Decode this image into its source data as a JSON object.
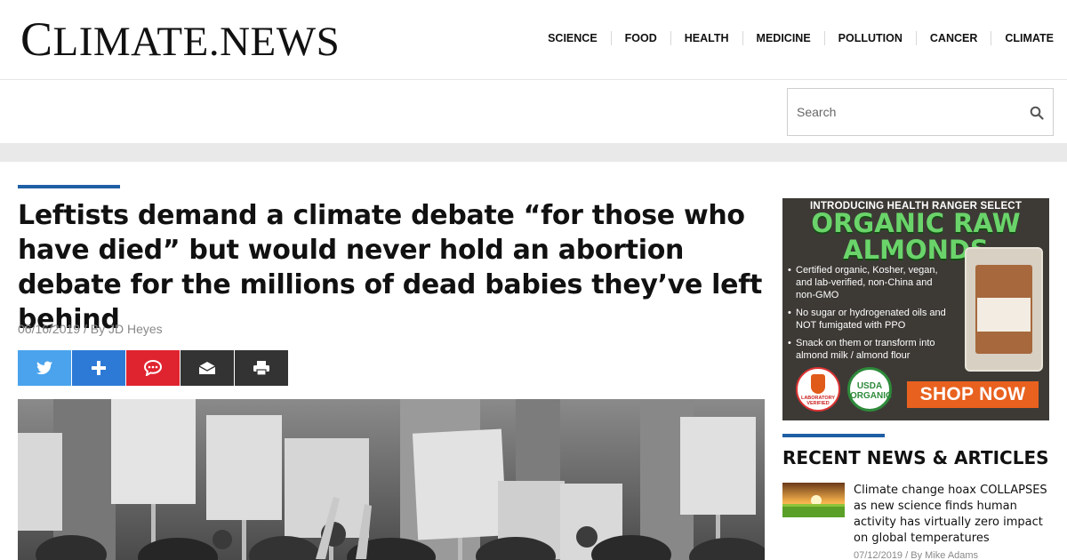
{
  "site": {
    "logo_cap": "C",
    "logo_rest": "LIMATE.NEWS"
  },
  "nav": [
    "SCIENCE",
    "FOOD",
    "HEALTH",
    "MEDICINE",
    "POLLUTION",
    "CANCER",
    "CLIMATE"
  ],
  "search": {
    "placeholder": "Search",
    "icon": "search-icon"
  },
  "article": {
    "headline": "Leftists demand a climate debate “for those who have died” but would never hold an abortion debate for the millions of dead babies they’ve left behind",
    "date": "06/16/2019",
    "separator": "/",
    "byline": "By JD Heyes",
    "share": [
      "twitter-icon",
      "plus-icon",
      "comment-icon",
      "email-icon",
      "print-icon"
    ],
    "colors": {
      "twitter": "#4aa3ec",
      "plus": "#2d7ad6",
      "comment": "#e0242f",
      "email": "#333333",
      "print": "#333333",
      "accent": "#1f5fa5"
    }
  },
  "ad": {
    "intro": "INTRODUCING HEALTH RANGER SELECT",
    "title_line1": "ORGANIC RAW",
    "title_line2": "ALMONDS",
    "bullets": [
      "Certified organic, Kosher, vegan, and lab-verified, non-China and non-GMO",
      "No sugar or hydrogenated oils and NOT fumigated with PPO",
      "Snack on them or transform into almond milk / almond flour"
    ],
    "seal_lab": "LABORATORY VERIFIED",
    "seal_usda_1": "USDA",
    "seal_usda_2": "ORGANIC",
    "cta": "SHOP NOW"
  },
  "recent": {
    "title": "RECENT NEWS & ARTICLES",
    "items": [
      {
        "headline": "Climate change hoax COLLAPSES as new science finds human activity has virtually zero impact on global temperatures",
        "date": "07/12/2019",
        "separator": "/",
        "byline": "By Mike Adams"
      }
    ]
  }
}
